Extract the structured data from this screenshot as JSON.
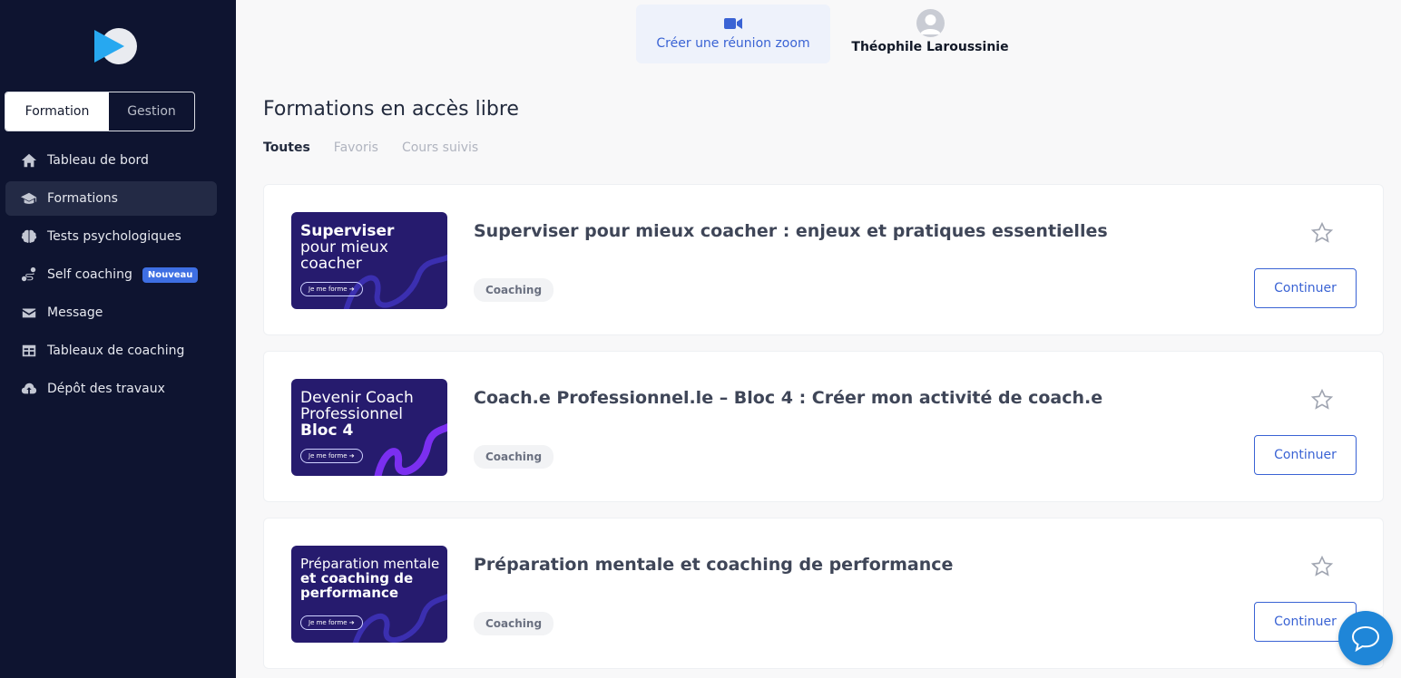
{
  "sidebar": {
    "segment": {
      "active": "Formation",
      "inactive": "Gestion"
    },
    "items": [
      {
        "label": "Tableau de bord",
        "icon": "home-icon"
      },
      {
        "label": "Formations",
        "icon": "graduation-cap-icon",
        "active": true
      },
      {
        "label": "Tests psychologiques",
        "icon": "brain-icon"
      },
      {
        "label": "Self coaching",
        "icon": "route-icon",
        "badge": "Nouveau"
      },
      {
        "label": "Message",
        "icon": "envelope-icon"
      },
      {
        "label": "Tableaux de coaching",
        "icon": "table-icon"
      },
      {
        "label": "Dépôt des travaux",
        "icon": "cloud-upload-icon"
      }
    ]
  },
  "header": {
    "zoom_label": "Créer une réunion zoom",
    "user_name": "Théophile Laroussinie"
  },
  "main": {
    "title": "Formations en accès libre",
    "tabs": [
      "Toutes",
      "Favoris",
      "Cours suivis"
    ],
    "courses": [
      {
        "title": "Superviser pour mieux coacher : enjeux et pratiques essentielles",
        "tag": "Coaching",
        "cta": "Continuer",
        "thumb_lines": [
          "Superviser",
          "pour mieux",
          "coacher"
        ],
        "thumb_cta": "Je me forme ➔"
      },
      {
        "title": "Coach.e Professionnel.le – Bloc 4 : Créer mon activité de coach.e",
        "tag": "Coaching",
        "cta": "Continuer",
        "thumb_lines": [
          "Devenir Coach",
          "Professionnel",
          "Bloc 4"
        ],
        "thumb_cta": "Je me forme ➔"
      },
      {
        "title": "Préparation mentale et coaching de performance",
        "tag": "Coaching",
        "cta": "Continuer",
        "thumb_lines": [
          "Préparation mentale",
          "et coaching de",
          "performance"
        ],
        "thumb_cta": "Je me forme ➔"
      }
    ]
  },
  "colors": {
    "sidebar_bg": "#0e1430",
    "accent": "#3a63d4",
    "badge": "#3e6fe3",
    "chat": "#1f86d8"
  }
}
